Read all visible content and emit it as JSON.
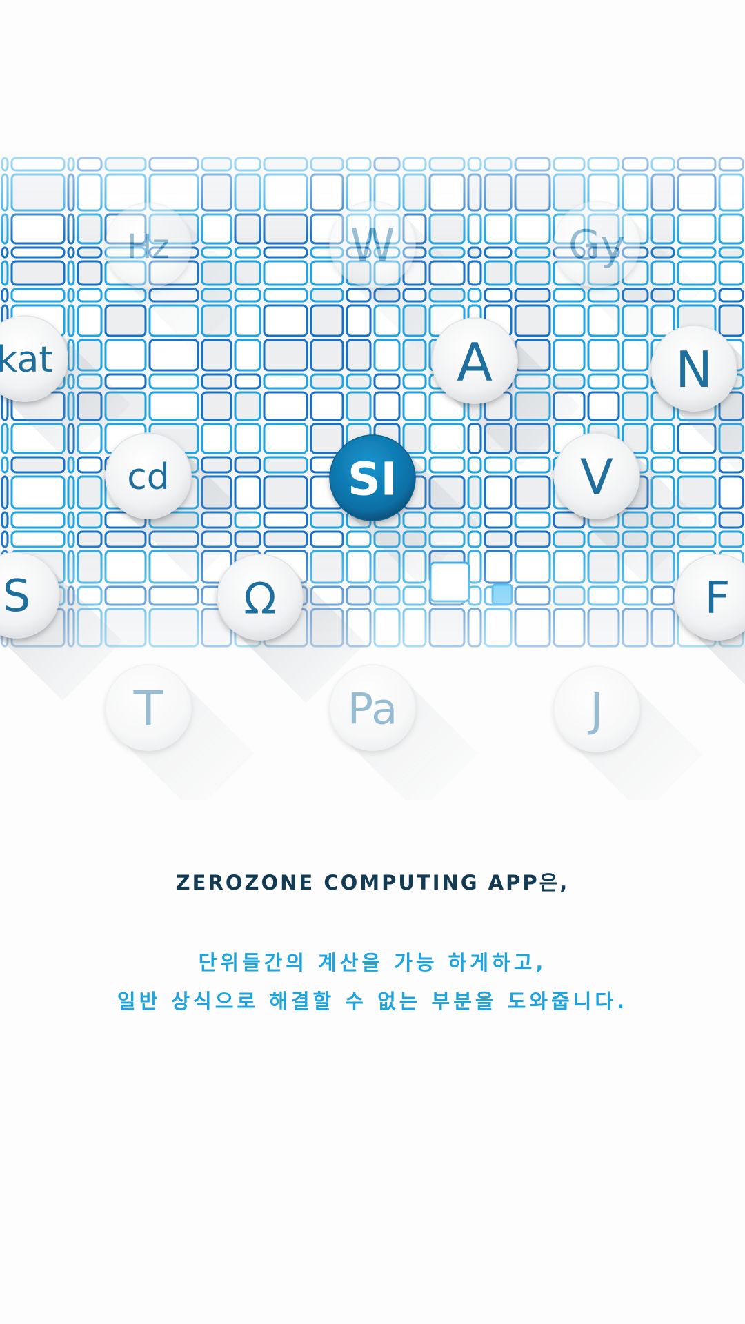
{
  "hero": {
    "units": [
      {
        "symbol": "Hz",
        "name": "unit-hz",
        "faded": true
      },
      {
        "symbol": "W",
        "name": "unit-w",
        "faded": true
      },
      {
        "symbol": "Gy",
        "name": "unit-gy",
        "faded": true
      },
      {
        "symbol": "kat",
        "name": "unit-kat",
        "faded": false
      },
      {
        "symbol": "A",
        "name": "unit-a",
        "faded": false
      },
      {
        "symbol": "N",
        "name": "unit-n",
        "faded": false
      },
      {
        "symbol": "cd",
        "name": "unit-cd",
        "faded": false
      },
      {
        "symbol": "SI",
        "name": "unit-si",
        "faded": false,
        "highlight": true
      },
      {
        "symbol": "V",
        "name": "unit-v",
        "faded": false
      },
      {
        "symbol": "S",
        "name": "unit-s",
        "faded": false
      },
      {
        "symbol": "Ω",
        "name": "unit-ohm",
        "faded": false
      },
      {
        "symbol": "F",
        "name": "unit-f",
        "faded": false
      },
      {
        "symbol": "T",
        "name": "unit-t",
        "faded": true
      },
      {
        "symbol": "Pa",
        "name": "unit-pa",
        "faded": true
      },
      {
        "symbol": "J",
        "name": "unit-j",
        "faded": true
      }
    ],
    "colors": {
      "grid_line": "#1ea3e4",
      "grid_line_dark": "#1671c9",
      "bubble_text": "#1e6f9e",
      "highlight_bg": "#0a6fa5",
      "highlight_text": "#ffffff"
    }
  },
  "copy": {
    "headline": "ZEROZONE COMPUTING APP은,",
    "line1": "단위들간의 계산을 가능 하게하고,",
    "line2": "일반 상식으로 해결할 수 없는 부분을 도와줍니다."
  }
}
